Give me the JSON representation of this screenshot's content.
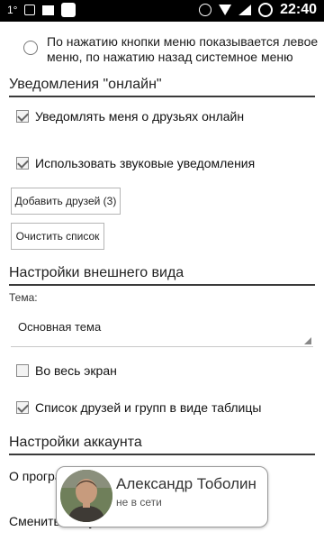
{
  "statusbar": {
    "left_text": "1°",
    "time": "22:40"
  },
  "radio_option": {
    "text": "По нажатию кнопки меню показывается левое меню, по нажатию назад системное меню",
    "checked": false
  },
  "notifications": {
    "header": "Уведомления \"онлайн\"",
    "friends_online_label": "Уведомлять меня о друзьях онлайн",
    "friends_online_checked": true,
    "sound_label": "Использовать звуковые уведомления",
    "sound_checked": true,
    "add_friends_button": "Добавить друзей (3)",
    "clear_list_button": "Очистить список"
  },
  "appearance": {
    "header": "Настройки внешнего вида",
    "theme_label": "Тема:",
    "theme_value": "Основная тема",
    "fullscreen_label": "Во весь экран",
    "fullscreen_checked": false,
    "grid_label": "Список друзей и групп в виде таблицы",
    "grid_checked": true
  },
  "account": {
    "header": "Настройки аккаунта",
    "about_label": "О програм",
    "change_account_label": "Сменить аккаунт"
  },
  "profile_card": {
    "name": "Александр Тоболин",
    "status": "не в сети"
  }
}
